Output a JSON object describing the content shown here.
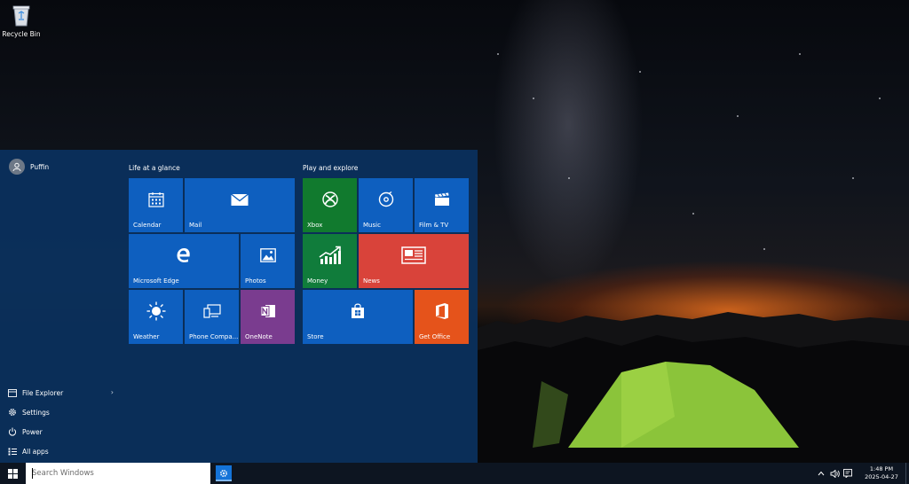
{
  "desktop": {
    "recycle_bin_label": "Recycle Bin"
  },
  "start_menu": {
    "user_name": "Puffin",
    "links": [
      {
        "label": "File Explorer",
        "icon": "folder-icon"
      },
      {
        "label": "Settings",
        "icon": "gear-icon"
      },
      {
        "label": "Power",
        "icon": "power-icon"
      },
      {
        "label": "All apps",
        "icon": "list-icon"
      }
    ],
    "groups": [
      {
        "title": "Life at a glance"
      },
      {
        "title": "Play and explore"
      }
    ],
    "tiles": {
      "calendar": "Calendar",
      "mail": "Mail",
      "edge": "Microsoft Edge",
      "photos": "Photos",
      "weather": "Weather",
      "phone": "Phone Compa...",
      "onenote": "OneNote",
      "xbox": "Xbox",
      "music": "Music",
      "film": "Film & TV",
      "money": "Money",
      "news": "News",
      "store": "Store",
      "office": "Get Office"
    },
    "colors": {
      "accent_blue": "#0e5fbf",
      "xbox_green": "#117a2e",
      "money_green": "#107c3b",
      "news_red": "#d9433a",
      "onenote_purple": "#7a3c8f",
      "office_orange": "#e5531b"
    }
  },
  "taskbar": {
    "search_placeholder": "Search Windows",
    "time": "1:48 PM",
    "date": "2025-04-27"
  }
}
